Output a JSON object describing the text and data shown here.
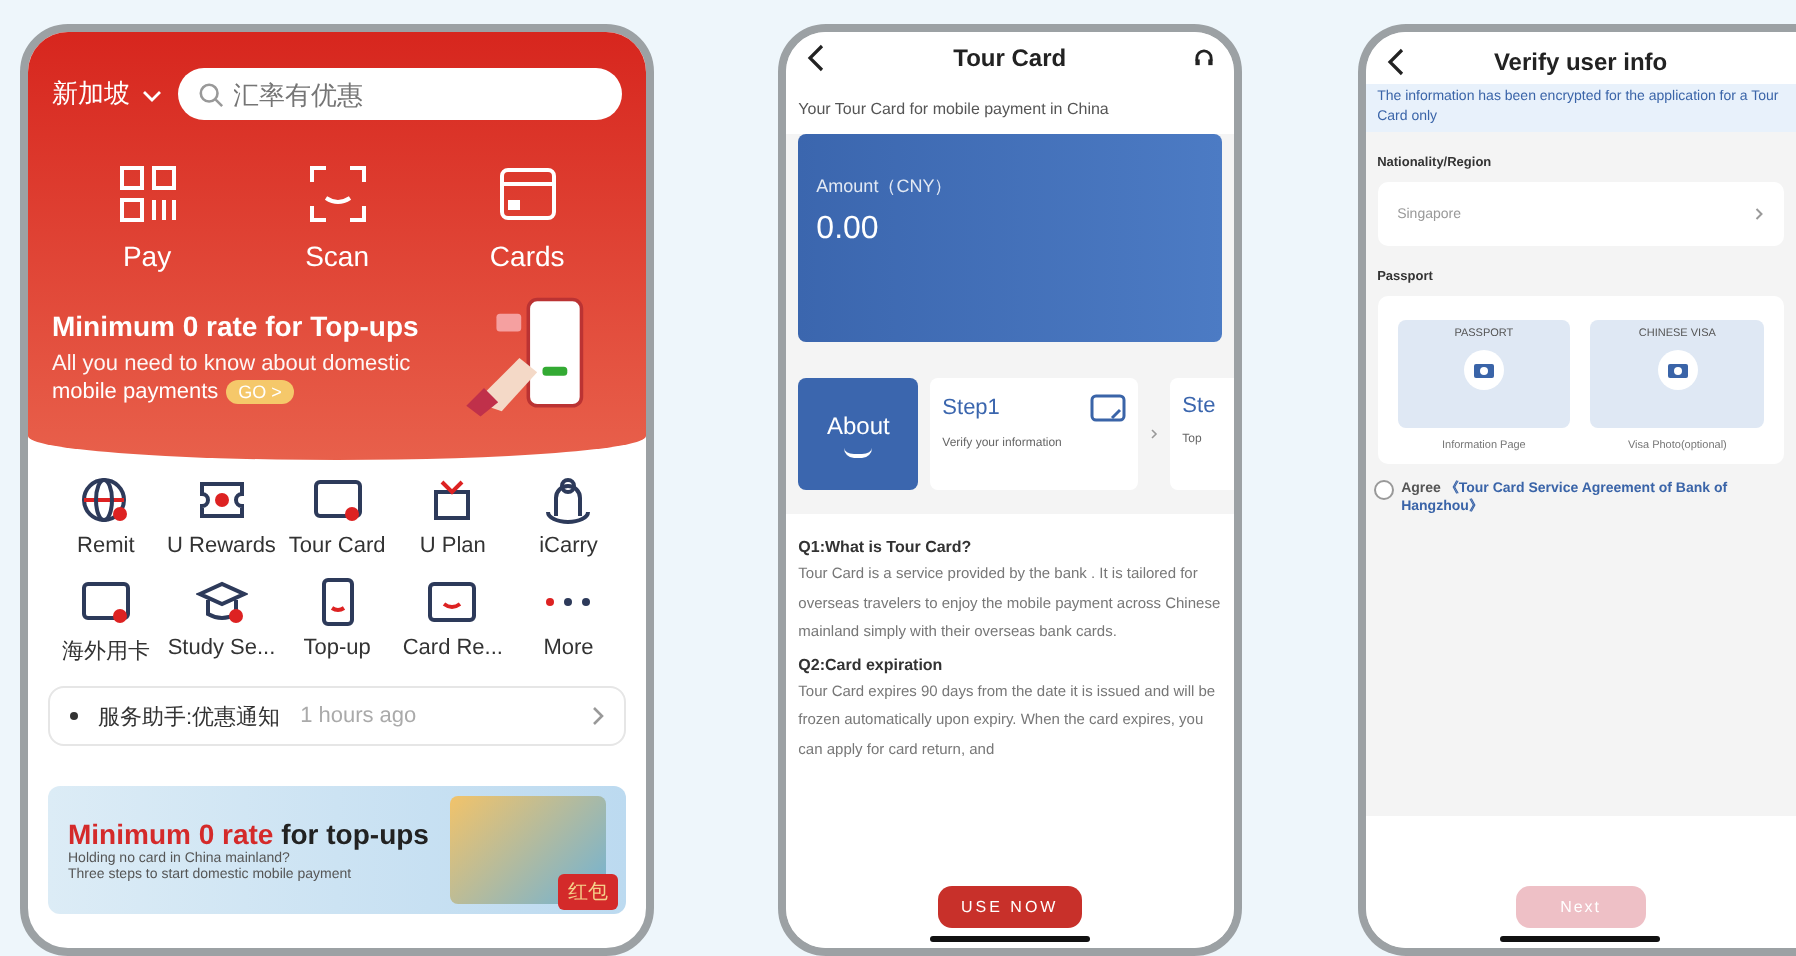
{
  "home": {
    "region": "新加坡",
    "search": {
      "placeholder": "汇率有优惠"
    },
    "quick_actions": [
      {
        "label": "Pay"
      },
      {
        "label": "Scan"
      },
      {
        "label": "Cards"
      }
    ],
    "banner": {
      "title": "Minimum 0 rate for Top-ups",
      "text_lines": [
        "All you need to know about domestic",
        "mobile payments"
      ],
      "button": "GO >"
    },
    "services": [
      {
        "label": "Remit"
      },
      {
        "label": "U Rewards"
      },
      {
        "label": "Tour Card"
      },
      {
        "label": "U Plan"
      },
      {
        "label": "iCarry"
      },
      {
        "label": "海外用卡"
      },
      {
        "label": "Study Se..."
      },
      {
        "label": "Top-up"
      },
      {
        "label": "Card Re..."
      },
      {
        "label": "More"
      }
    ],
    "notice": {
      "text": "服务助手:优惠通知",
      "time": "1 hours ago"
    },
    "promo": {
      "title_highlight": "Minimum 0 rate",
      "title_rest": "for top-ups",
      "lines": [
        "Holding no card in China mainland?",
        "Three steps to start domestic mobile payment"
      ],
      "badge": "红包"
    }
  },
  "tour_card": {
    "title": "Tour Card",
    "subtitle": "Your Tour Card for mobile payment in China",
    "amount_label": "Amount（CNY）",
    "amount": "0.00",
    "tabs": [
      {
        "label": "About",
        "selected": true
      }
    ],
    "steps": [
      {
        "title": "Step1",
        "text": "Verify your information"
      },
      {
        "title": "Ste",
        "text": "Top"
      }
    ],
    "faq": [
      {
        "question": "Q1:What is Tour Card?",
        "answer": "Tour Card is a service provided by the bank . It is tailored for overseas travelers to enjoy the mobile payment across Chinese mainland simply with their overseas bank cards."
      },
      {
        "question": "Q2:Card expiration",
        "answer": "Tour Card expires 90 days from the date it is issued and will be frozen automatically upon expiry. When the card expires, you can apply for card return, and"
      }
    ],
    "button": "USE NOW"
  },
  "verify": {
    "title": "Verify user info",
    "notice": "The information has been encrypted for the application for a Tour Card only",
    "nationality_label": "Nationality/Region",
    "nationality": "Singapore",
    "passport_label": "Passport",
    "documents": [
      {
        "caption": "PASSPORT",
        "label": "Information Page"
      },
      {
        "caption": "CHINESE VISA",
        "label": "Visa Photo(optional)"
      }
    ],
    "agree": {
      "label": "Agree",
      "link": "《Tour Card Service Agreement of Bank of Hangzhou》",
      "checked": false
    },
    "button": {
      "label": "Next",
      "disabled": true
    }
  }
}
